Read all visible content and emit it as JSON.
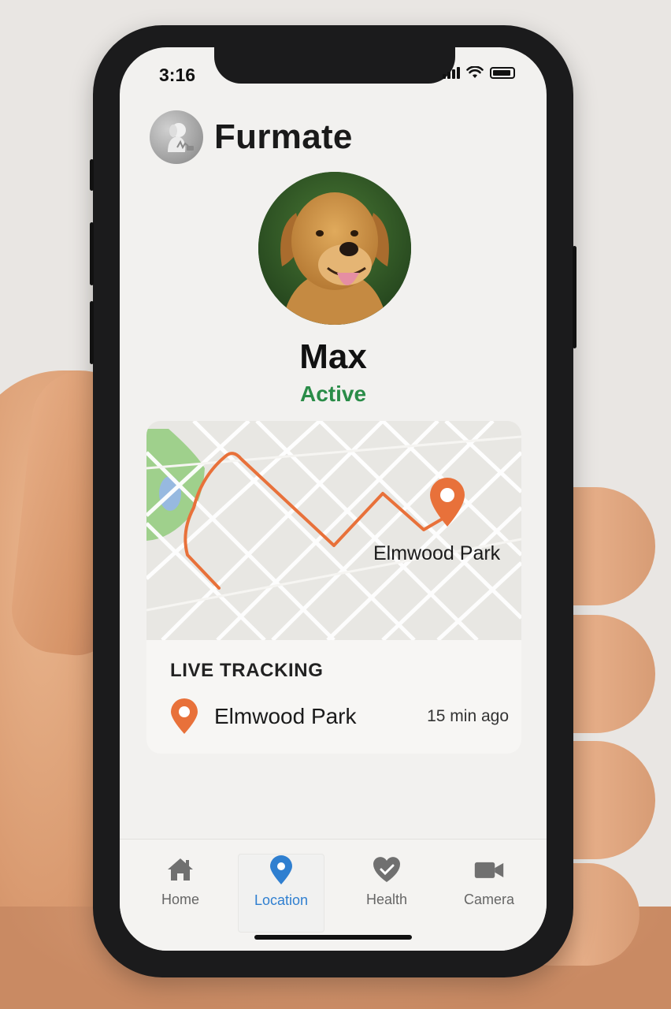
{
  "status_bar": {
    "time": "3:16"
  },
  "app": {
    "title": "Furmate"
  },
  "pet": {
    "name": "Max",
    "status": "Active"
  },
  "map": {
    "place_label": "Elmwood Park"
  },
  "tracking": {
    "title": "LIVE TRACKING",
    "place": "Elmwood Park",
    "time_ago": "15 min ago"
  },
  "tabs": [
    {
      "label": "Home",
      "icon": "home-icon"
    },
    {
      "label": "Location",
      "icon": "location-pin-icon",
      "active": true
    },
    {
      "label": "Health",
      "icon": "heart-icon"
    },
    {
      "label": "Camera",
      "icon": "video-camera-icon"
    }
  ],
  "colors": {
    "accent_orange": "#e8713a",
    "active_green": "#2a8c48",
    "tab_active_blue": "#2f7fd0"
  }
}
